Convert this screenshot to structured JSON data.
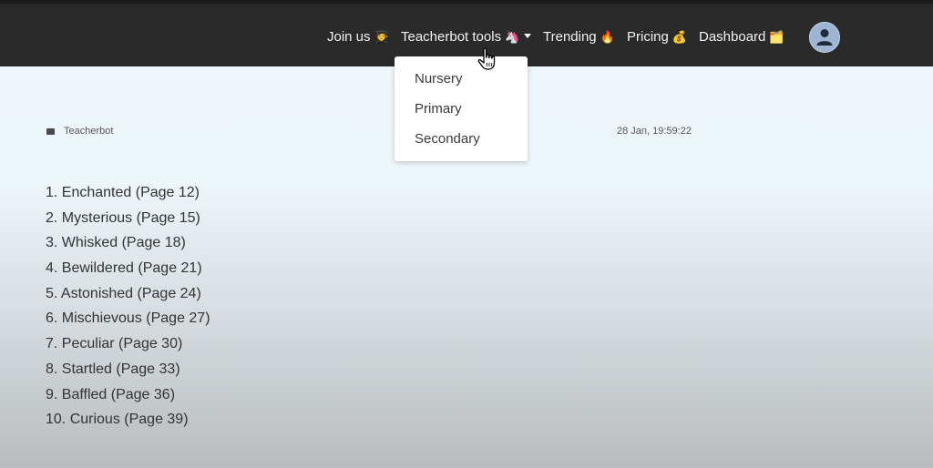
{
  "nav": {
    "items": [
      {
        "label": "Join us",
        "emoji": "🧑‍🎓"
      },
      {
        "label": "Teacherbot tools",
        "emoji": "🦄"
      },
      {
        "label": "Trending",
        "emoji": "🔥"
      },
      {
        "label": "Pricing",
        "emoji": "💰"
      },
      {
        "label": "Dashboard",
        "emoji": "🗂️"
      }
    ]
  },
  "dropdown": {
    "items": [
      "Nursery",
      "Primary",
      "Secondary"
    ]
  },
  "message": {
    "author": "Teacherbot",
    "timestamp": "28 Jan, 19:59:22",
    "lines": [
      "1. Enchanted (Page 12)",
      "2. Mysterious (Page 15)",
      "3. Whisked (Page 18)",
      "4. Bewildered (Page 21)",
      "5. Astonished (Page 24)",
      "6. Mischievous (Page 27)",
      "7. Peculiar (Page 30)",
      "8. Startled (Page 33)",
      "9. Baffled (Page 36)",
      "10. Curious (Page 39)"
    ]
  },
  "icons": {
    "avatar": "user-avatar-icon",
    "author": "message-icon",
    "cursor": "hand-pointer-icon"
  }
}
